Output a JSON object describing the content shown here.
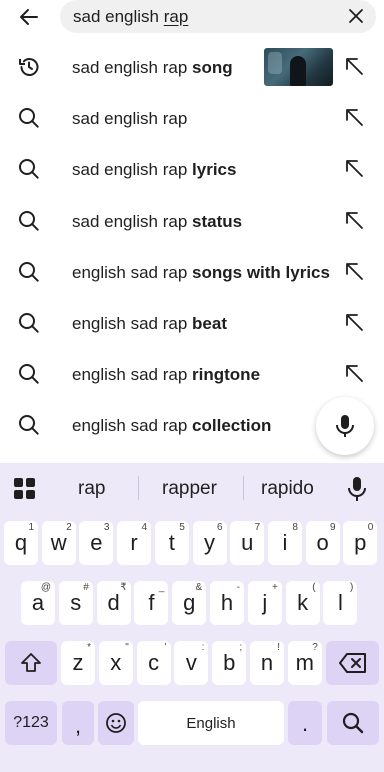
{
  "search": {
    "query_prefix": "sad english ",
    "query_cursor_word": "rap"
  },
  "suggestions": [
    {
      "prefix": "sad english rap ",
      "bold": "song",
      "lead_icon": "history-icon",
      "has_thumbnail": true
    },
    {
      "prefix": "sad english rap",
      "bold": "",
      "lead_icon": "search-icon"
    },
    {
      "prefix": "sad english rap ",
      "bold": "lyrics",
      "lead_icon": "search-icon"
    },
    {
      "prefix": "sad english rap ",
      "bold": "status",
      "lead_icon": "search-icon"
    },
    {
      "prefix": "english sad rap ",
      "bold": "songs with lyrics",
      "lead_icon": "search-icon"
    },
    {
      "prefix": "english sad rap ",
      "bold": "beat",
      "lead_icon": "search-icon"
    },
    {
      "prefix": "english sad rap ",
      "bold": "ringtone",
      "lead_icon": "search-icon"
    },
    {
      "prefix": "english sad rap ",
      "bold": "collection",
      "lead_icon": "search-icon"
    }
  ],
  "keyboard": {
    "word_suggestions": [
      "rap",
      "rapper",
      "rapido"
    ],
    "row1": [
      {
        "k": "q",
        "h": "1"
      },
      {
        "k": "w",
        "h": "2"
      },
      {
        "k": "e",
        "h": "3"
      },
      {
        "k": "r",
        "h": "4"
      },
      {
        "k": "t",
        "h": "5"
      },
      {
        "k": "y",
        "h": "6"
      },
      {
        "k": "u",
        "h": "7"
      },
      {
        "k": "i",
        "h": "8"
      },
      {
        "k": "o",
        "h": "9"
      },
      {
        "k": "p",
        "h": "0"
      }
    ],
    "row2": [
      {
        "k": "a",
        "h": "@"
      },
      {
        "k": "s",
        "h": "#"
      },
      {
        "k": "d",
        "h": "₹"
      },
      {
        "k": "f",
        "h": "_"
      },
      {
        "k": "g",
        "h": "&"
      },
      {
        "k": "h",
        "h": "-"
      },
      {
        "k": "j",
        "h": "+"
      },
      {
        "k": "k",
        "h": "("
      },
      {
        "k": "l",
        "h": ")"
      }
    ],
    "row3": [
      {
        "k": "z",
        "h": "*"
      },
      {
        "k": "x",
        "h": "\""
      },
      {
        "k": "c",
        "h": "'"
      },
      {
        "k": "v",
        "h": ":"
      },
      {
        "k": "b",
        "h": ";"
      },
      {
        "k": "n",
        "h": "!"
      },
      {
        "k": "m",
        "h": "?"
      }
    ],
    "symbols_label": "?123",
    "comma_label": ",",
    "space_label": "English",
    "period_label": "."
  },
  "colors": {
    "keyboard_bg": "#eee9f8",
    "function_key": "#ddd3f4",
    "search_bg": "#f0f0f0"
  }
}
